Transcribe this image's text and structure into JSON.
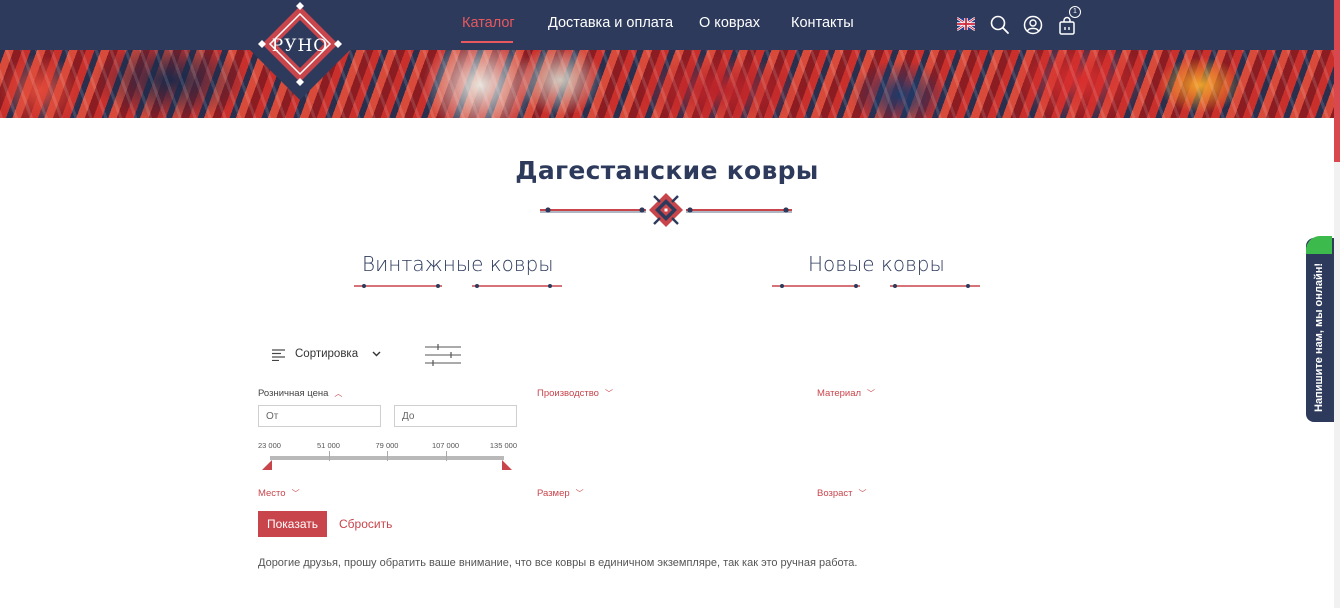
{
  "header": {
    "logo_text": "РУНО",
    "nav": [
      {
        "label": "Каталог"
      },
      {
        "label": "Доставка и оплата"
      },
      {
        "label": "О коврах"
      },
      {
        "label": "Контакты"
      }
    ],
    "cart_count": "1"
  },
  "page": {
    "title": "Дагестанские ковры",
    "subcategories": [
      {
        "label": "Винтажные ковры"
      },
      {
        "label": "Новые ковры"
      }
    ]
  },
  "toolbar": {
    "sort_label": "Сортировка"
  },
  "filters": {
    "price": {
      "label": "Розничная цена",
      "from_placeholder": "От",
      "to_placeholder": "До",
      "ticks": [
        "23 000",
        "51 000",
        "79 000",
        "107 000",
        "135 000"
      ],
      "range_min": 23000,
      "range_max": 135000,
      "selected_min": 23000,
      "selected_max": 135000
    },
    "production": {
      "label": "Производство"
    },
    "material": {
      "label": "Материал"
    },
    "place": {
      "label": "Место"
    },
    "size": {
      "label": "Размер"
    },
    "age": {
      "label": "Возраст"
    }
  },
  "actions": {
    "show_label": "Показать",
    "reset_label": "Сбросить"
  },
  "notice": "Дорогие друзья, прошу обратить ваше внимание, что все ковры в единичном экземпляре, так как это ручная работа.",
  "chat": {
    "label": "Напишите нам, мы онлайн!"
  },
  "colors": {
    "navy": "#2d3a5c",
    "accent": "#c8454c",
    "nav_active": "#e8585e",
    "chat_online": "#3cba4b"
  },
  "icons": [
    "uk-flag-icon",
    "search-icon",
    "user-icon",
    "cart-icon",
    "sort-lines-icon",
    "chevron-down-icon",
    "filter-sliders-icon"
  ]
}
